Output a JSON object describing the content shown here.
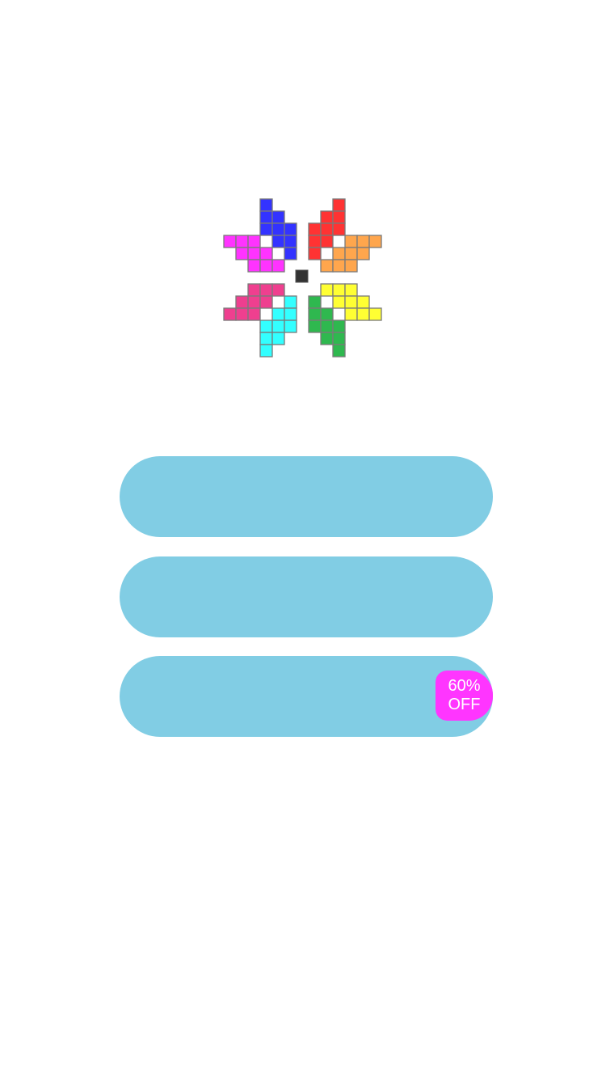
{
  "logo": {
    "center_dot_color": "#333333",
    "pieces": [
      {
        "name": "blue",
        "color": "#3333ff"
      },
      {
        "name": "red",
        "color": "#ff3333"
      },
      {
        "name": "magenta",
        "color": "#ff33ff"
      },
      {
        "name": "orange",
        "color": "#ffa64d"
      },
      {
        "name": "pink",
        "color": "#ef3f8f"
      },
      {
        "name": "cyan",
        "color": "#33ffff"
      },
      {
        "name": "yellow",
        "color": "#ffff33"
      },
      {
        "name": "green",
        "color": "#2fb84f"
      }
    ]
  },
  "menu": {
    "button_color": "#81cde4",
    "buttons": [
      {
        "label": ""
      },
      {
        "label": ""
      },
      {
        "label": ""
      }
    ],
    "badge": {
      "line1": "60%",
      "line2": "OFF",
      "color": "#ff35ff"
    }
  }
}
